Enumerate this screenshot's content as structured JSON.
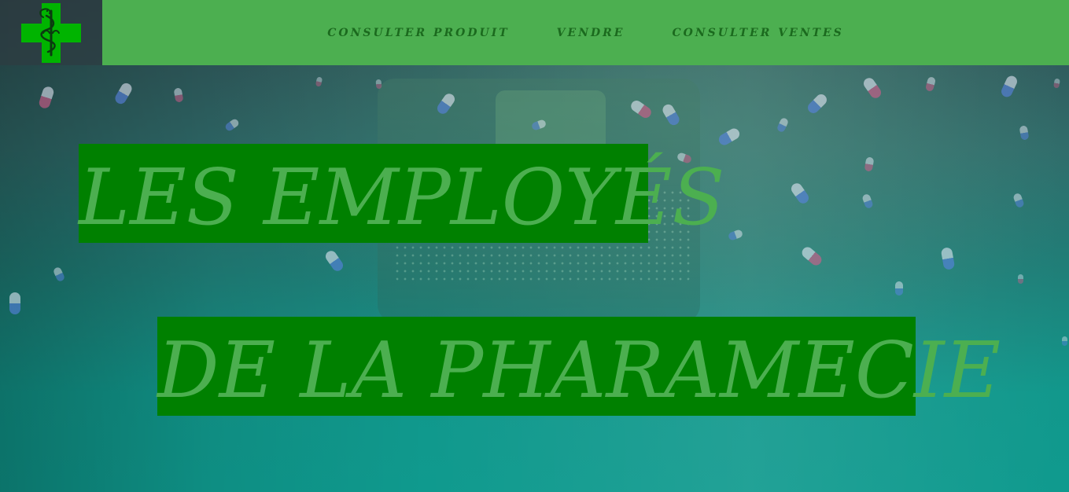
{
  "brand": {
    "logo_icon": "pharmacy-cross-caduceus-icon"
  },
  "nav": {
    "items": [
      {
        "label": "CONSULTER PRODUIT"
      },
      {
        "label": "VENDRE"
      },
      {
        "label": "CONSULTER VENTES"
      }
    ]
  },
  "hero": {
    "line1": "LES EMPLOYÉS",
    "line2": "DE LA PHARAMECIE"
  },
  "colors": {
    "nav_bg": "#4caf50",
    "nav_text": "#1b6a1e",
    "title_bg": "#008000",
    "title_text": "#4caf50"
  }
}
